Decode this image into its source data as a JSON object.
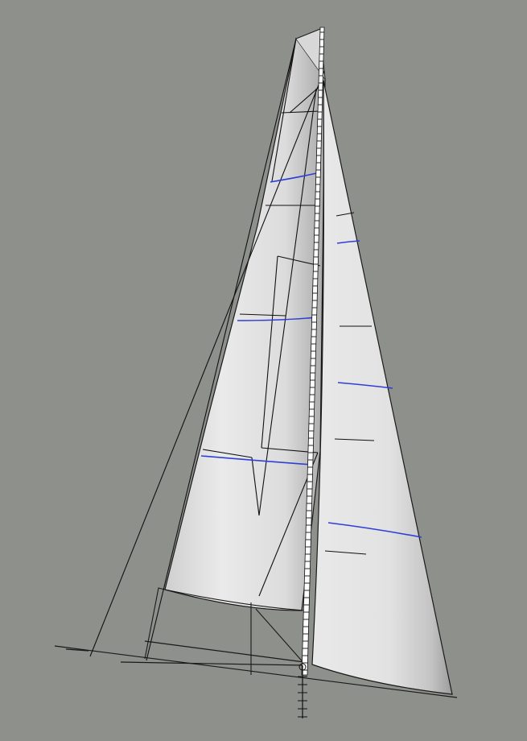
{
  "viewport": {
    "background": "#8e908c",
    "view": "sail-plan-3d-render"
  },
  "colors": {
    "background": "#8e908c",
    "sail_light": "#f2f2f2",
    "sail_shade": "#b8b8b8",
    "rigging": "#111111",
    "draft_stripe": "#2f3fd6",
    "mast": "#ffffff"
  },
  "sails": [
    {
      "name": "mainsail",
      "draft_stripes": 3
    },
    {
      "name": "jib",
      "draft_stripes": 4
    }
  ]
}
